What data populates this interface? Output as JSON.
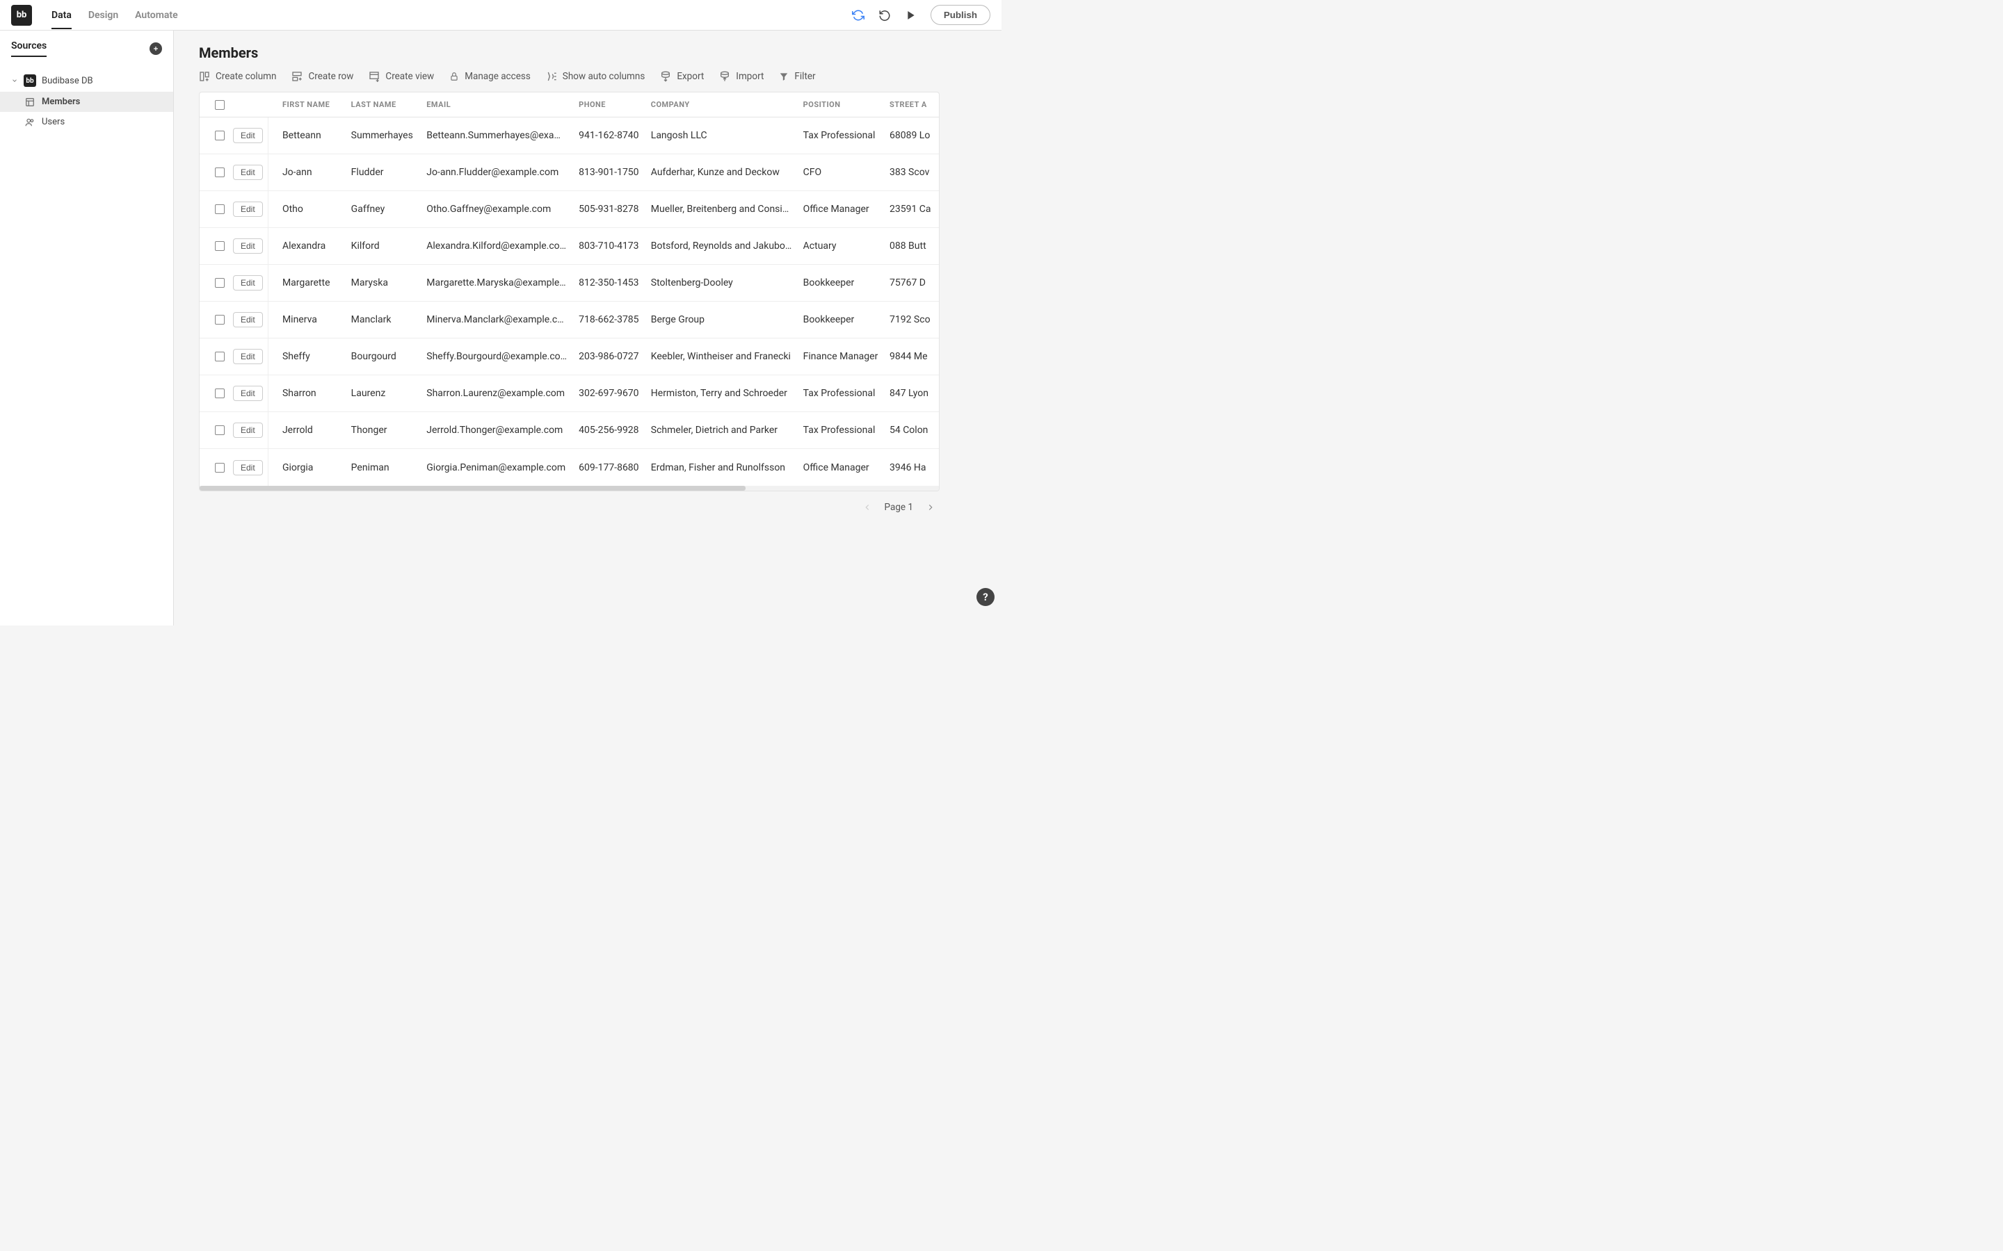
{
  "logo_text": "bb",
  "top_tabs": {
    "data": "Data",
    "design": "Design",
    "automate": "Automate"
  },
  "publish": "Publish",
  "sidebar": {
    "title": "Sources",
    "db": "Budibase DB",
    "members": "Members",
    "users": "Users"
  },
  "page_title": "Members",
  "toolbar": {
    "create_column": "Create column",
    "create_row": "Create row",
    "create_view": "Create view",
    "manage_access": "Manage access",
    "show_auto": "Show auto columns",
    "export": "Export",
    "import": "Import",
    "filter": "Filter"
  },
  "columns": {
    "first": "First Name",
    "last": "Last Name",
    "email": "Email",
    "phone": "Phone",
    "company": "Company",
    "position": "Position",
    "street": "Street A"
  },
  "edit_label": "Edit",
  "rows": [
    {
      "first": "Betteann",
      "last": "Summerhayes",
      "email": "Betteann.Summerhayes@exam…",
      "phone": "941-162-8740",
      "company": "Langosh LLC",
      "position": "Tax Professional",
      "street": "68089 Lo"
    },
    {
      "first": "Jo-ann",
      "last": "Fludder",
      "email": "Jo-ann.Fludder@example.com",
      "phone": "813-901-1750",
      "company": "Aufderhar, Kunze and Deckow",
      "position": "CFO",
      "street": "383 Scov"
    },
    {
      "first": "Otho",
      "last": "Gaffney",
      "email": "Otho.Gaffney@example.com",
      "phone": "505-931-8278",
      "company": "Mueller, Breitenberg and Consid…",
      "position": "Office Manager",
      "street": "23591 Ca"
    },
    {
      "first": "Alexandra",
      "last": "Kilford",
      "email": "Alexandra.Kilford@example.com",
      "phone": "803-710-4173",
      "company": "Botsford, Reynolds and Jakubo…",
      "position": "Actuary",
      "street": "088 Butt"
    },
    {
      "first": "Margarette",
      "last": "Maryska",
      "email": "Margarette.Maryska@example.c…",
      "phone": "812-350-1453",
      "company": "Stoltenberg-Dooley",
      "position": "Bookkeeper",
      "street": "75767 D"
    },
    {
      "first": "Minerva",
      "last": "Manclark",
      "email": "Minerva.Manclark@example.com",
      "phone": "718-662-3785",
      "company": "Berge Group",
      "position": "Bookkeeper",
      "street": "7192 Sco"
    },
    {
      "first": "Sheffy",
      "last": "Bourgourd",
      "email": "Sheffy.Bourgourd@example.com",
      "phone": "203-986-0727",
      "company": "Keebler, Wintheiser and Franecki",
      "position": "Finance Manager",
      "street": "9844 Me"
    },
    {
      "first": "Sharron",
      "last": "Laurenz",
      "email": "Sharron.Laurenz@example.com",
      "phone": "302-697-9670",
      "company": "Hermiston, Terry and Schroeder",
      "position": "Tax Professional",
      "street": "847 Lyon"
    },
    {
      "first": "Jerrold",
      "last": "Thonger",
      "email": "Jerrold.Thonger@example.com",
      "phone": "405-256-9928",
      "company": "Schmeler, Dietrich and Parker",
      "position": "Tax Professional",
      "street": "54 Colon"
    },
    {
      "first": "Giorgia",
      "last": "Peniman",
      "email": "Giorgia.Peniman@example.com",
      "phone": "609-177-8680",
      "company": "Erdman, Fisher and Runolfsson",
      "position": "Office Manager",
      "street": "3946 Ha"
    }
  ],
  "pagination": {
    "label": "Page 1"
  },
  "help": "?"
}
